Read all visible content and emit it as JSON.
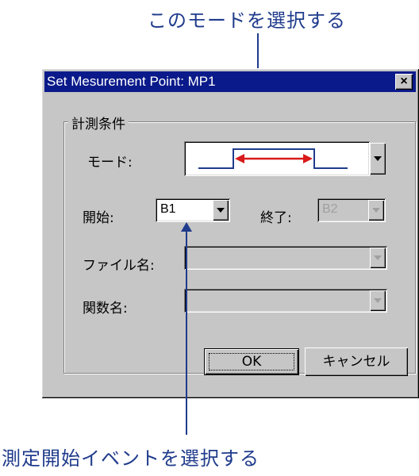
{
  "annotations": {
    "top": "このモードを選択する",
    "bottom": "測定開始イベントを選択する"
  },
  "dialog": {
    "title": "Set Mesurement Point: MP1",
    "close_glyph": "×",
    "group_label": "計測条件",
    "mode_label": "モード:",
    "start_label": "開始:",
    "start_value": "B1",
    "end_label": "終了:",
    "end_value": "B2",
    "file_label": "ファイル名:",
    "func_label": "関数名:",
    "ok_label": "OK",
    "cancel_label": "キャンセル"
  },
  "colors": {
    "annotation": "#1f3b8c",
    "titlebar": "#0a1a8a",
    "mode_waveform": "#1f3b8c",
    "mode_arrow": "#d81a1a"
  }
}
